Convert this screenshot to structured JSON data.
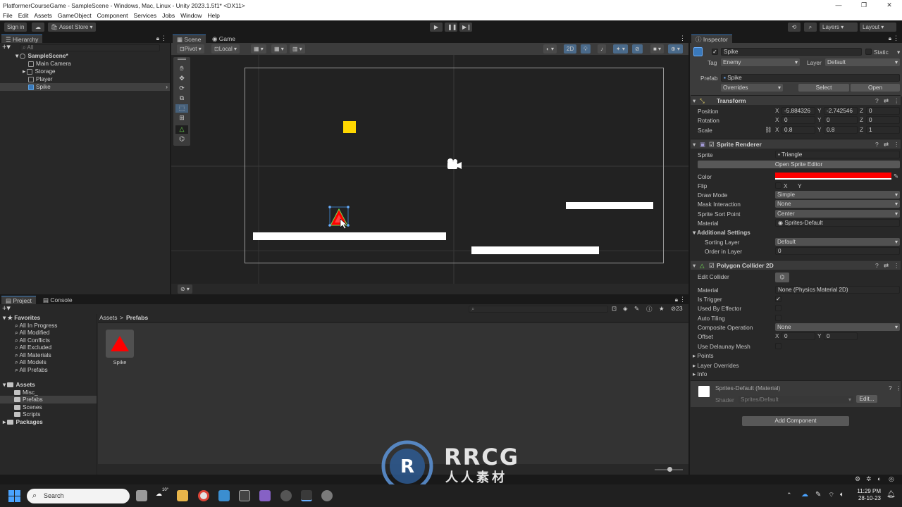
{
  "window": {
    "title": "PlatformerCourseGame - SampleScene - Windows, Mac, Linux - Unity 2023.1.5f1* <DX11>",
    "controls": [
      "—",
      "❐",
      "✕"
    ]
  },
  "menu": [
    "File",
    "Edit",
    "Assets",
    "GameObject",
    "Component",
    "Services",
    "Jobs",
    "Window",
    "Help"
  ],
  "toolbar": {
    "sign_in": "Sign in",
    "asset_store": "Asset Store",
    "layers": "Layers",
    "layout": "Layout"
  },
  "hierarchy": {
    "tab": "Hierarchy",
    "search_placeholder": "All",
    "scene": "SampleScene*",
    "items": [
      "Main Camera",
      "Storage",
      "Player",
      "Spike"
    ]
  },
  "scene_view": {
    "tabs": [
      "Scene",
      "Game"
    ],
    "pivot": "Pivot",
    "local": "Local",
    "mode_2d": "2D"
  },
  "project": {
    "tabs": [
      "Project",
      "Console"
    ],
    "count": "23",
    "breadcrumb": [
      "Assets",
      "Prefabs"
    ],
    "favorites_label": "Favorites",
    "favorites": [
      "All In Progress",
      "All Modified",
      "All Conflicts",
      "All Excluded",
      "All Materials",
      "All Models",
      "All Prefabs"
    ],
    "assets_label": "Assets",
    "folders": [
      "Misc_",
      "Prefabs",
      "Scenes",
      "Scripts"
    ],
    "packages_label": "Packages",
    "asset_item": "Spike"
  },
  "inspector": {
    "tab": "Inspector",
    "name": "Spike",
    "static": "Static",
    "tag_label": "Tag",
    "tag": "Enemy",
    "layer_label": "Layer",
    "layer": "Default",
    "prefab_label": "Prefab",
    "prefab": "Spike",
    "overrides": "Overrides",
    "select": "Select",
    "open": "Open",
    "transform": {
      "title": "Transform",
      "position_label": "Position",
      "rotation_label": "Rotation",
      "scale_label": "Scale",
      "position": [
        "-5.884326",
        "-2.742546",
        "0"
      ],
      "rotation": [
        "0",
        "0",
        "0"
      ],
      "scale": [
        "0.8",
        "0.8",
        "1"
      ]
    },
    "sprite_renderer": {
      "title": "Sprite Renderer",
      "sprite_label": "Sprite",
      "sprite": "Triangle",
      "open_editor": "Open Sprite Editor",
      "color_label": "Color",
      "color": "#ff0000",
      "flip_label": "Flip",
      "flip_x": "X",
      "flip_y": "Y",
      "draw_mode_label": "Draw Mode",
      "draw_mode": "Simple",
      "mask_label": "Mask Interaction",
      "mask": "None",
      "sort_point_label": "Sprite Sort Point",
      "sort_point": "Center",
      "material_label": "Material",
      "material": "Sprites-Default",
      "additional": "Additional Settings",
      "sorting_layer_label": "Sorting Layer",
      "sorting_layer": "Default",
      "order_label": "Order in Layer",
      "order": "0"
    },
    "polygon_collider": {
      "title": "Polygon Collider 2D",
      "edit_label": "Edit Collider",
      "material_label": "Material",
      "material": "None (Physics Material 2D)",
      "is_trigger_label": "Is Trigger",
      "used_by_effector_label": "Used By Effector",
      "auto_tiling_label": "Auto Tiling",
      "composite_label": "Composite Operation",
      "composite": "None",
      "offset_label": "Offset",
      "offset": [
        "0",
        "0"
      ],
      "delaunay_label": "Use Delaunay Mesh",
      "points_label": "Points",
      "layer_overrides_label": "Layer Overrides",
      "info_label": "Info"
    },
    "material_section": {
      "title": "Sprites-Default (Material)",
      "shader_label": "Shader",
      "shader": "Sprites/Default",
      "edit": "Edit..."
    },
    "add_component": "Add Component"
  },
  "taskbar": {
    "search": "Search",
    "weather": "10°",
    "time": "11:29 PM",
    "date": "28-10-23"
  },
  "watermark": {
    "brand": "RRCG",
    "subtitle": "人人素材"
  },
  "colors": {
    "accent": "#3a79bb",
    "spike": "#ff0000",
    "coin": "#ffd700"
  }
}
